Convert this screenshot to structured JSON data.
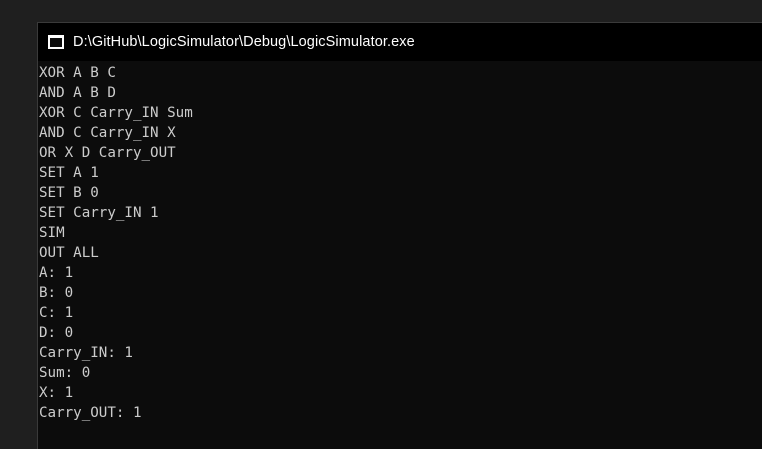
{
  "window": {
    "title": "D:\\GitHub\\LogicSimulator\\Debug\\LogicSimulator.exe",
    "icon": "console-app-icon"
  },
  "console": {
    "lines": [
      "XOR A B C",
      "AND A B D",
      "XOR C Carry_IN Sum",
      "AND C Carry_IN X",
      "OR X D Carry_OUT",
      "SET A 1",
      "SET B 0",
      "SET Carry_IN 1",
      "SIM",
      "OUT ALL",
      "A: 1",
      "B: 0",
      "C: 1",
      "D: 0",
      "Carry_IN: 1",
      "Sum: 0",
      "X: 1",
      "Carry_OUT: 1"
    ]
  },
  "colors": {
    "console_background": "#0c0c0c",
    "console_text": "#cccccc",
    "titlebar_background": "#000000",
    "title_text": "#ffffff"
  }
}
